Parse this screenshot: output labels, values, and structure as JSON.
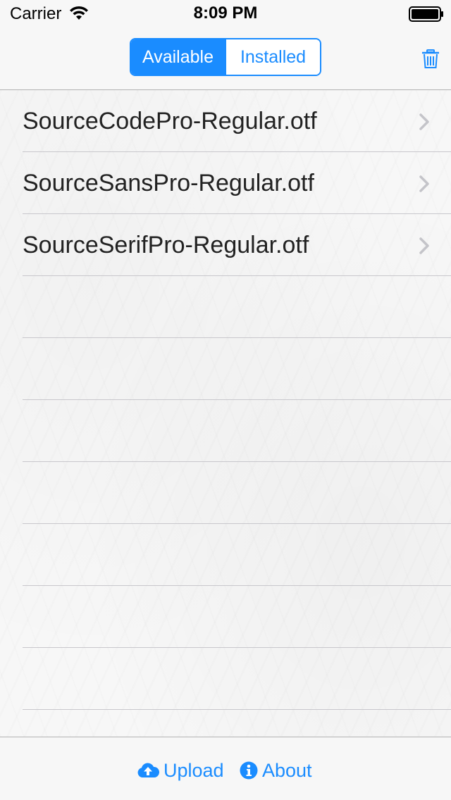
{
  "status_bar": {
    "carrier": "Carrier",
    "time": "8:09 PM",
    "icons": [
      "wifi-icon",
      "battery-icon"
    ]
  },
  "nav": {
    "segments": [
      {
        "label": "Available",
        "selected": true
      },
      {
        "label": "Installed",
        "selected": false
      }
    ],
    "right_icon": "trash-icon"
  },
  "fonts": [
    {
      "label": "SourceCodePro-Regular.otf"
    },
    {
      "label": "SourceSansPro-Regular.otf"
    },
    {
      "label": "SourceSerifPro-Regular.otf"
    }
  ],
  "toolbar": {
    "upload_label": "Upload",
    "upload_icon": "cloud-upload-icon",
    "about_label": "About",
    "about_icon": "info-icon"
  },
  "colors": {
    "accent": "#1a8cff",
    "separator": "#c8c7cc",
    "text": "#222222"
  }
}
